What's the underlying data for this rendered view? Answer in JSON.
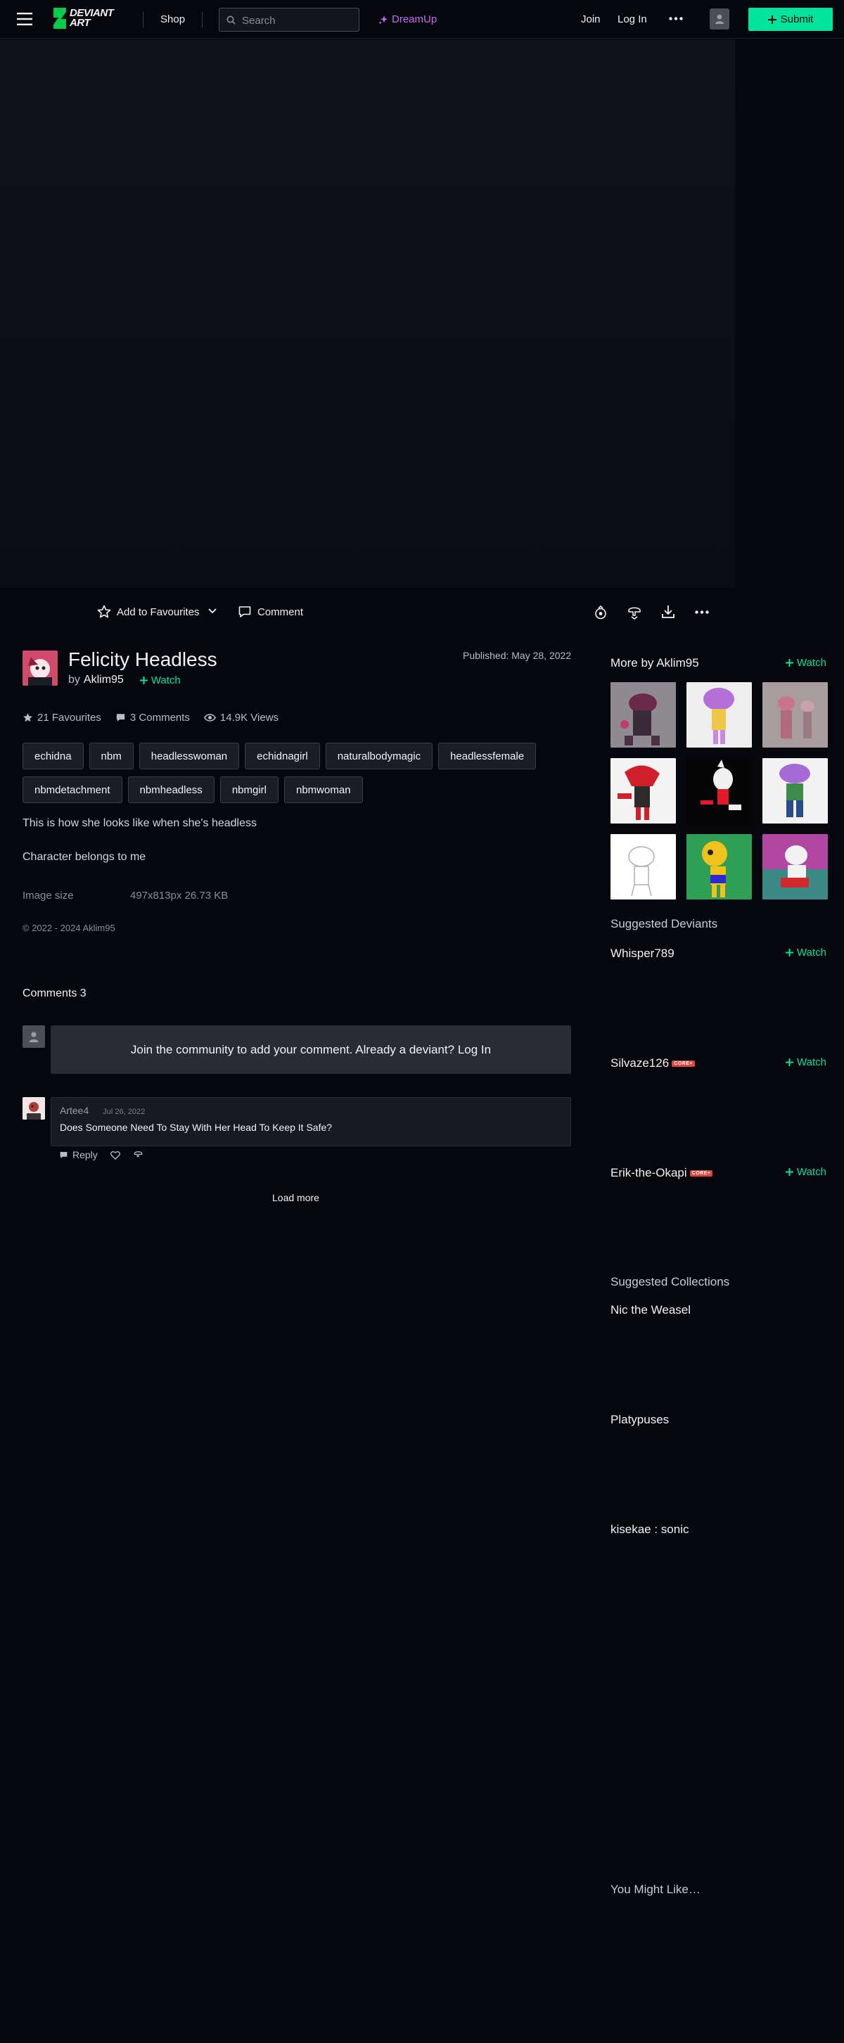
{
  "header": {
    "logo_line1": "DEVIANT",
    "logo_line2": "ART",
    "shop": "Shop",
    "search_placeholder": "Search",
    "dreamup": "DreamUp",
    "join": "Join",
    "login": "Log In",
    "submit": "Submit"
  },
  "actions": {
    "favourite": "Add to Favourites",
    "comment": "Comment"
  },
  "deviation": {
    "title": "Felicity Headless",
    "by": "by",
    "author": "Aklim95",
    "watch": "Watch",
    "published": "Published: May 28, 2022",
    "favourites": "21 Favourites",
    "comments": "3 Comments",
    "views": "14.9K Views",
    "tags_row1": [
      "echidna",
      "nbm",
      "headlesswoman",
      "echidnagirl",
      "naturalbodymagic",
      "headlessfemale"
    ],
    "tags_row2": [
      "nbmdetachment",
      "nbmheadless",
      "nbmgirl",
      "nbmwoman"
    ],
    "description1": "This is how she looks like when she's headless",
    "description2": "Character belongs to me",
    "image_size_label": "Image size",
    "image_size_value": "497x813px 26.73 KB",
    "copyright": "© 2022 - 2024 Aklim95"
  },
  "comments_section": {
    "heading": "Comments 3",
    "join_prompt": "Join the community to add your comment. Already a deviant? Log In",
    "comment_author": "Artee4",
    "comment_date": "Jul 26, 2022",
    "comment_text": "Does Someone Need To Stay With Her Head To Keep It Safe?",
    "reply": "Reply",
    "load_more": "Load more"
  },
  "sidebar": {
    "more_by": "More by Aklim95",
    "watch": "Watch",
    "suggested_deviants": "Suggested Deviants",
    "deviants": [
      {
        "name": "Whisper789",
        "badge": ""
      },
      {
        "name": "Silvaze126",
        "badge": "CORE+"
      },
      {
        "name": "Erik-the-Okapi",
        "badge": "CORE+"
      }
    ],
    "suggested_collections": "Suggested Collections",
    "collections": [
      "Nic the Weasel",
      "Platypuses",
      "kisekae : sonic"
    ],
    "you_might_like": "You Might Like…"
  }
}
